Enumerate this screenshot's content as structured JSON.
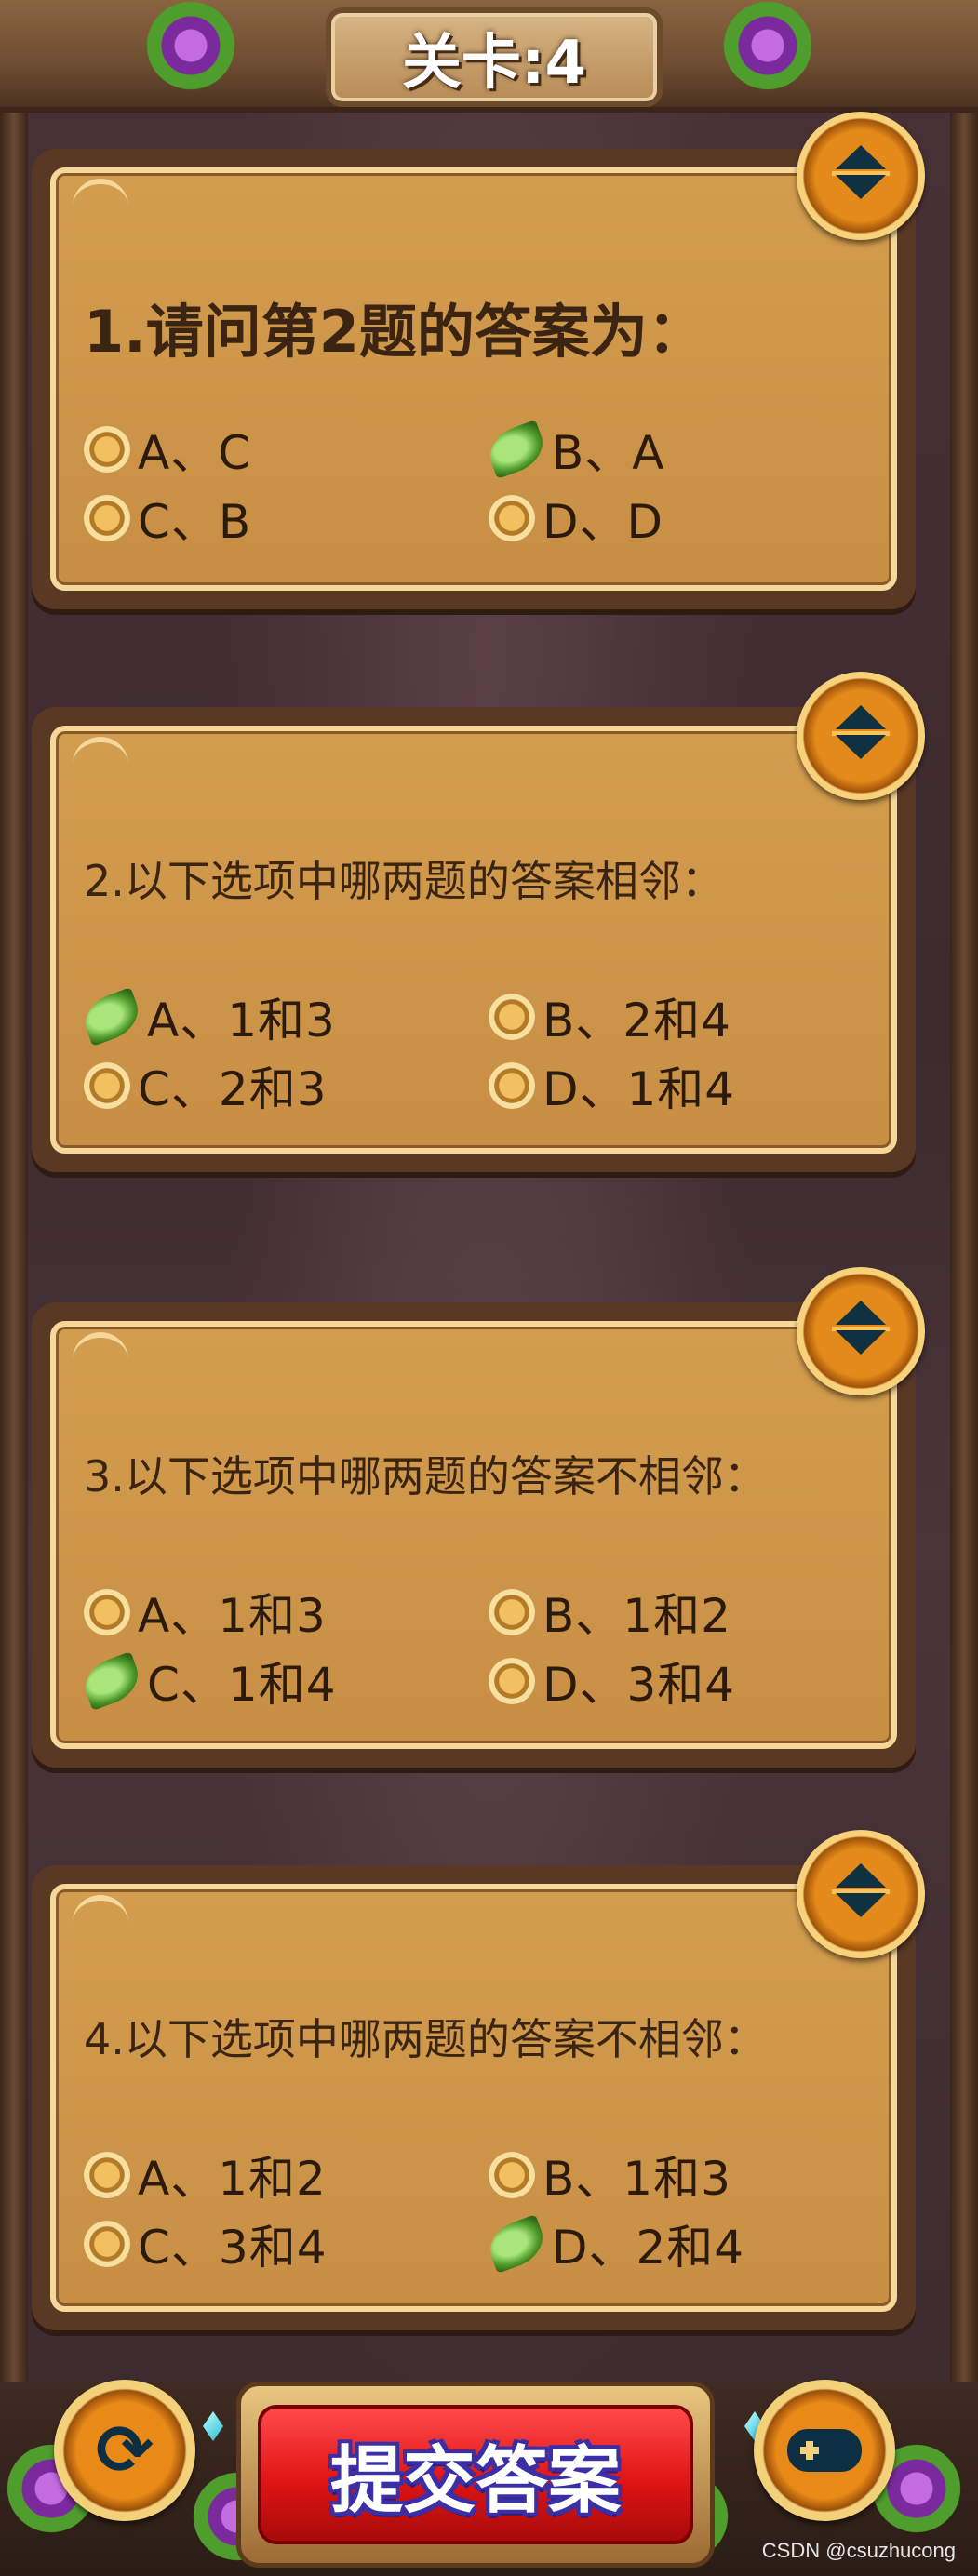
{
  "header": {
    "title": "关卡:4"
  },
  "questions": [
    {
      "text": "1.请问第2题的答案为：",
      "options": [
        {
          "label": "A、C",
          "selected": false
        },
        {
          "label": "B、A",
          "selected": true
        },
        {
          "label": "C、B",
          "selected": false
        },
        {
          "label": "D、D",
          "selected": false
        }
      ]
    },
    {
      "text": "2.以下选项中哪两题的答案相邻：",
      "options": [
        {
          "label": "A、1和3",
          "selected": true
        },
        {
          "label": "B、2和4",
          "selected": false
        },
        {
          "label": "C、2和3",
          "selected": false
        },
        {
          "label": "D、1和4",
          "selected": false
        }
      ]
    },
    {
      "text": "3.以下选项中哪两题的答案不相邻：",
      "options": [
        {
          "label": "A、1和3",
          "selected": false
        },
        {
          "label": "B、1和2",
          "selected": false
        },
        {
          "label": "C、1和4",
          "selected": true
        },
        {
          "label": "D、3和4",
          "selected": false
        }
      ]
    },
    {
      "text": "4.以下选项中哪两题的答案不相邻：",
      "options": [
        {
          "label": "A、1和2",
          "selected": false
        },
        {
          "label": "B、1和3",
          "selected": false
        },
        {
          "label": "C、3和4",
          "selected": false
        },
        {
          "label": "D、2和4",
          "selected": true
        }
      ]
    }
  ],
  "footer": {
    "submit_label": "提交答案",
    "refresh_glyph": "⟳",
    "watermark": "CSDN @csuzhucong"
  },
  "icons": {
    "toggle": "expand-collapse-icon",
    "refresh": "refresh-icon",
    "gamepad": "gamepad-icon",
    "selected_radio": "leaf-icon"
  }
}
